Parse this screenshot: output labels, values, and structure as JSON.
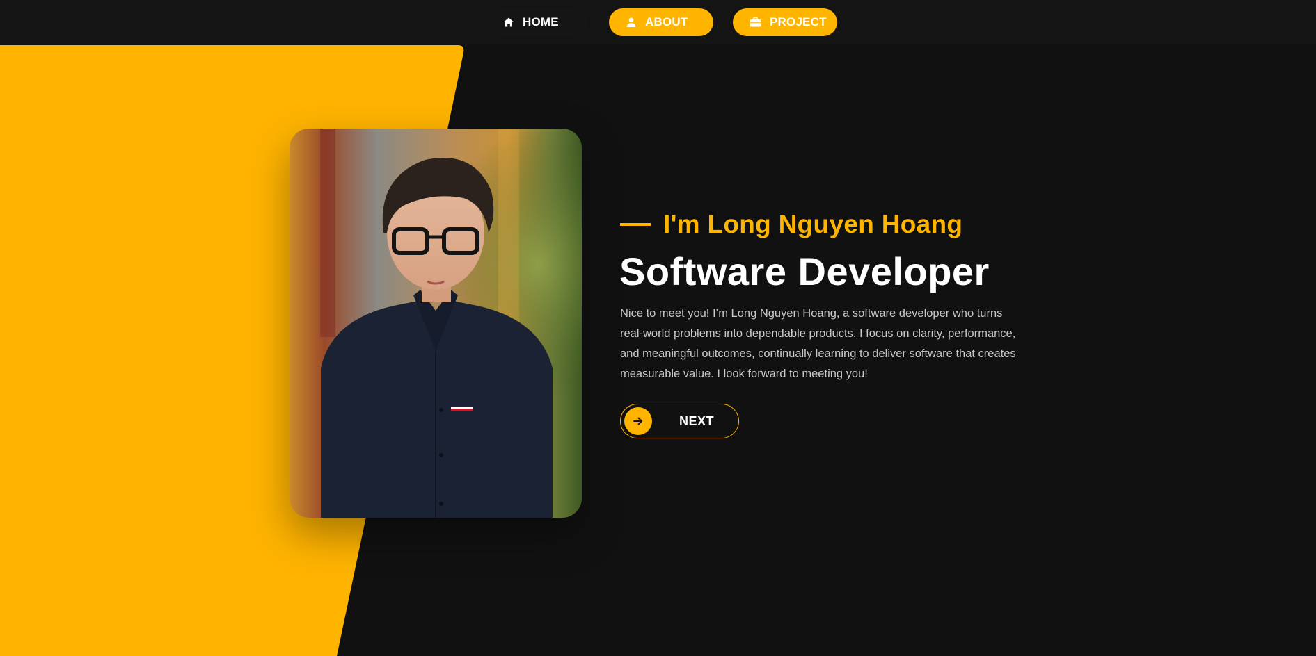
{
  "nav": {
    "home": {
      "label": "HOME",
      "icon": "home-icon"
    },
    "about": {
      "label": "ABOUT",
      "icon": "user-icon"
    },
    "project": {
      "label": "PROJECT",
      "icon": "briefcase-icon"
    }
  },
  "hero": {
    "intro": "I'm Long Nguyen Hoang",
    "headline": "Software Developer",
    "description": "Nice to meet you! I’m Long Nguyen Hoang, a software developer who turns real-world problems into dependable products. I focus on clarity, performance, and meaningful outcomes, continually learning to deliver software that creates measurable value. I look forward to meeting you!",
    "next_label": "NEXT",
    "next_icon": "arrow-right-icon"
  },
  "colors": {
    "accent": "#ffb400",
    "background": "#111111",
    "text": "#ffffff",
    "muted_text": "#c9c9c9"
  }
}
